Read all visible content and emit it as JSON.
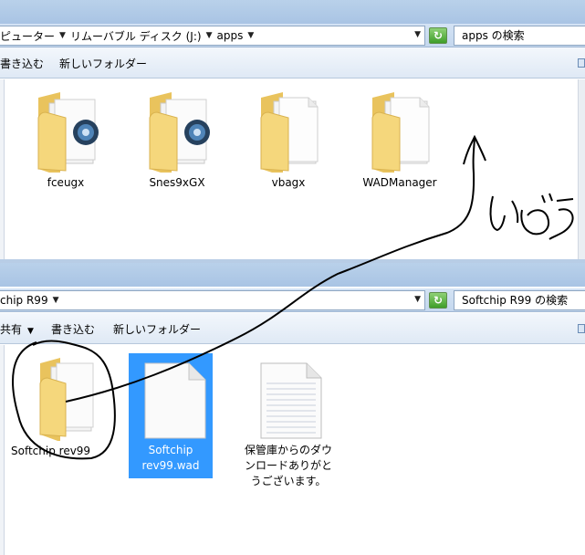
{
  "top_window": {
    "breadcrumb": [
      "ピューター",
      "リムーバブル ディスク (J:)",
      "apps"
    ],
    "search_placeholder": "apps の検索",
    "toolbar": [
      "書き込む",
      "新しいフォルダー"
    ],
    "items": [
      {
        "name": "fceugx",
        "icon": "folder-with-app-icon"
      },
      {
        "name": "Snes9xGX",
        "icon": "folder-with-app-icon"
      },
      {
        "name": "vbagx",
        "icon": "folder-with-document-icon"
      },
      {
        "name": "WADManager",
        "icon": "folder-with-document-icon"
      }
    ]
  },
  "bottom_window": {
    "breadcrumb": [
      "chip R99"
    ],
    "search_placeholder": "Softchip R99 の検索",
    "toolbar": [
      "共有",
      "書き込む",
      "新しいフォルダー"
    ],
    "items": [
      {
        "name": "Softchip rev99",
        "icon": "folder-icon",
        "selected": false
      },
      {
        "name_line1": "Softchip",
        "name_line2": "rev99.wad",
        "icon": "file-icon",
        "selected": true
      },
      {
        "name_line1": "保管庫からのダウ",
        "name_line2": "ンロードありがと",
        "name_line3": "うございます。",
        "icon": "text-document-icon",
        "selected": false
      }
    ]
  },
  "annotation": {
    "handwritten_text": "いどう",
    "color": "#000000"
  },
  "colors": {
    "selection": "#3399ff",
    "folder": "#f4d27a",
    "chrome": "#c4d7ee"
  }
}
